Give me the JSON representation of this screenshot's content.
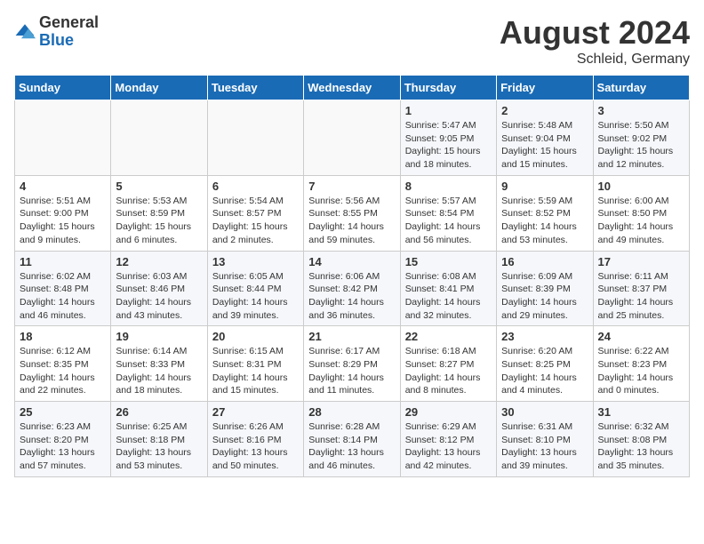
{
  "header": {
    "logo_general": "General",
    "logo_blue": "Blue",
    "month_year": "August 2024",
    "location": "Schleid, Germany"
  },
  "days_of_week": [
    "Sunday",
    "Monday",
    "Tuesday",
    "Wednesday",
    "Thursday",
    "Friday",
    "Saturday"
  ],
  "weeks": [
    [
      {
        "day": "",
        "info": ""
      },
      {
        "day": "",
        "info": ""
      },
      {
        "day": "",
        "info": ""
      },
      {
        "day": "",
        "info": ""
      },
      {
        "day": "1",
        "info": "Sunrise: 5:47 AM\nSunset: 9:05 PM\nDaylight: 15 hours\nand 18 minutes."
      },
      {
        "day": "2",
        "info": "Sunrise: 5:48 AM\nSunset: 9:04 PM\nDaylight: 15 hours\nand 15 minutes."
      },
      {
        "day": "3",
        "info": "Sunrise: 5:50 AM\nSunset: 9:02 PM\nDaylight: 15 hours\nand 12 minutes."
      }
    ],
    [
      {
        "day": "4",
        "info": "Sunrise: 5:51 AM\nSunset: 9:00 PM\nDaylight: 15 hours\nand 9 minutes."
      },
      {
        "day": "5",
        "info": "Sunrise: 5:53 AM\nSunset: 8:59 PM\nDaylight: 15 hours\nand 6 minutes."
      },
      {
        "day": "6",
        "info": "Sunrise: 5:54 AM\nSunset: 8:57 PM\nDaylight: 15 hours\nand 2 minutes."
      },
      {
        "day": "7",
        "info": "Sunrise: 5:56 AM\nSunset: 8:55 PM\nDaylight: 14 hours\nand 59 minutes."
      },
      {
        "day": "8",
        "info": "Sunrise: 5:57 AM\nSunset: 8:54 PM\nDaylight: 14 hours\nand 56 minutes."
      },
      {
        "day": "9",
        "info": "Sunrise: 5:59 AM\nSunset: 8:52 PM\nDaylight: 14 hours\nand 53 minutes."
      },
      {
        "day": "10",
        "info": "Sunrise: 6:00 AM\nSunset: 8:50 PM\nDaylight: 14 hours\nand 49 minutes."
      }
    ],
    [
      {
        "day": "11",
        "info": "Sunrise: 6:02 AM\nSunset: 8:48 PM\nDaylight: 14 hours\nand 46 minutes."
      },
      {
        "day": "12",
        "info": "Sunrise: 6:03 AM\nSunset: 8:46 PM\nDaylight: 14 hours\nand 43 minutes."
      },
      {
        "day": "13",
        "info": "Sunrise: 6:05 AM\nSunset: 8:44 PM\nDaylight: 14 hours\nand 39 minutes."
      },
      {
        "day": "14",
        "info": "Sunrise: 6:06 AM\nSunset: 8:42 PM\nDaylight: 14 hours\nand 36 minutes."
      },
      {
        "day": "15",
        "info": "Sunrise: 6:08 AM\nSunset: 8:41 PM\nDaylight: 14 hours\nand 32 minutes."
      },
      {
        "day": "16",
        "info": "Sunrise: 6:09 AM\nSunset: 8:39 PM\nDaylight: 14 hours\nand 29 minutes."
      },
      {
        "day": "17",
        "info": "Sunrise: 6:11 AM\nSunset: 8:37 PM\nDaylight: 14 hours\nand 25 minutes."
      }
    ],
    [
      {
        "day": "18",
        "info": "Sunrise: 6:12 AM\nSunset: 8:35 PM\nDaylight: 14 hours\nand 22 minutes."
      },
      {
        "day": "19",
        "info": "Sunrise: 6:14 AM\nSunset: 8:33 PM\nDaylight: 14 hours\nand 18 minutes."
      },
      {
        "day": "20",
        "info": "Sunrise: 6:15 AM\nSunset: 8:31 PM\nDaylight: 14 hours\nand 15 minutes."
      },
      {
        "day": "21",
        "info": "Sunrise: 6:17 AM\nSunset: 8:29 PM\nDaylight: 14 hours\nand 11 minutes."
      },
      {
        "day": "22",
        "info": "Sunrise: 6:18 AM\nSunset: 8:27 PM\nDaylight: 14 hours\nand 8 minutes."
      },
      {
        "day": "23",
        "info": "Sunrise: 6:20 AM\nSunset: 8:25 PM\nDaylight: 14 hours\nand 4 minutes."
      },
      {
        "day": "24",
        "info": "Sunrise: 6:22 AM\nSunset: 8:23 PM\nDaylight: 14 hours\nand 0 minutes."
      }
    ],
    [
      {
        "day": "25",
        "info": "Sunrise: 6:23 AM\nSunset: 8:20 PM\nDaylight: 13 hours\nand 57 minutes."
      },
      {
        "day": "26",
        "info": "Sunrise: 6:25 AM\nSunset: 8:18 PM\nDaylight: 13 hours\nand 53 minutes."
      },
      {
        "day": "27",
        "info": "Sunrise: 6:26 AM\nSunset: 8:16 PM\nDaylight: 13 hours\nand 50 minutes."
      },
      {
        "day": "28",
        "info": "Sunrise: 6:28 AM\nSunset: 8:14 PM\nDaylight: 13 hours\nand 46 minutes."
      },
      {
        "day": "29",
        "info": "Sunrise: 6:29 AM\nSunset: 8:12 PM\nDaylight: 13 hours\nand 42 minutes."
      },
      {
        "day": "30",
        "info": "Sunrise: 6:31 AM\nSunset: 8:10 PM\nDaylight: 13 hours\nand 39 minutes."
      },
      {
        "day": "31",
        "info": "Sunrise: 6:32 AM\nSunset: 8:08 PM\nDaylight: 13 hours\nand 35 minutes."
      }
    ]
  ]
}
